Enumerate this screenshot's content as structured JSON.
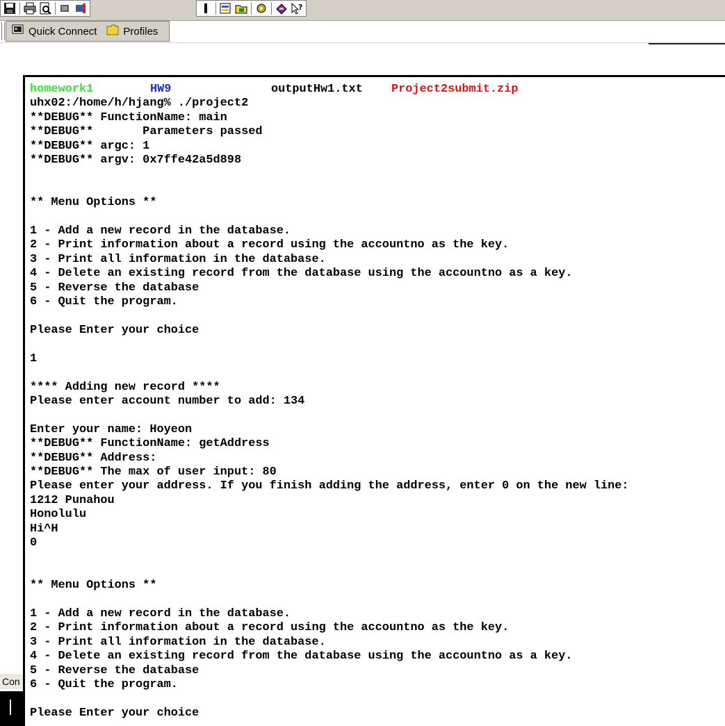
{
  "toolbar": {
    "icons": [
      "save-icon",
      "print-icon",
      "print-preview-icon",
      "connect-icon",
      "disconnect-icon",
      "cursor-icon",
      "file-transfer-icon",
      "open-folder-icon",
      "settings-icon",
      "help-topics-icon",
      "context-help-icon"
    ]
  },
  "quickbar": {
    "quick_connect_label": "Quick Connect",
    "profiles_label": "Profiles"
  },
  "side": {
    "conn_fragment": "Con"
  },
  "terminal": {
    "ls": [
      {
        "text": "homework1",
        "color": "green"
      },
      {
        "text": "HW9",
        "color": "blue"
      },
      {
        "text": "outputHw1.txt",
        "color": "plain"
      },
      {
        "text": "Project2submit.zip",
        "color": "red"
      }
    ],
    "lines": [
      "uhx02:/home/h/hjang% ./project2",
      "**DEBUG** FunctionName: main",
      "**DEBUG**       Parameters passed",
      "**DEBUG** argc: 1",
      "**DEBUG** argv: 0x7ffe42a5d898",
      "",
      "",
      "** Menu Options **",
      "",
      "1 - Add a new record in the database.",
      "2 - Print information about a record using the accountno as the key.",
      "3 - Print all information in the database.",
      "4 - Delete an existing record from the database using the accountno as a key.",
      "5 - Reverse the database",
      "6 - Quit the program.",
      "",
      "Please Enter your choice",
      "",
      "1",
      "",
      "**** Adding new record ****",
      "Please enter account number to add: 134",
      "",
      "Enter your name: Hoyeon",
      "**DEBUG** FunctionName: getAddress",
      "**DEBUG** Address:",
      "**DEBUG** The max of user input: 80",
      "Please enter your address. If you finish adding the address, enter 0 on the new line:",
      "1212 Punahou",
      "Honolulu",
      "Hi^H",
      "0",
      "",
      "",
      "** Menu Options **",
      "",
      "1 - Add a new record in the database.",
      "2 - Print information about a record using the accountno as the key.",
      "3 - Print all information in the database.",
      "4 - Delete an existing record from the database using the accountno as a key.",
      "5 - Reverse the database",
      "6 - Quit the program.",
      "",
      "Please Enter your choice"
    ]
  }
}
